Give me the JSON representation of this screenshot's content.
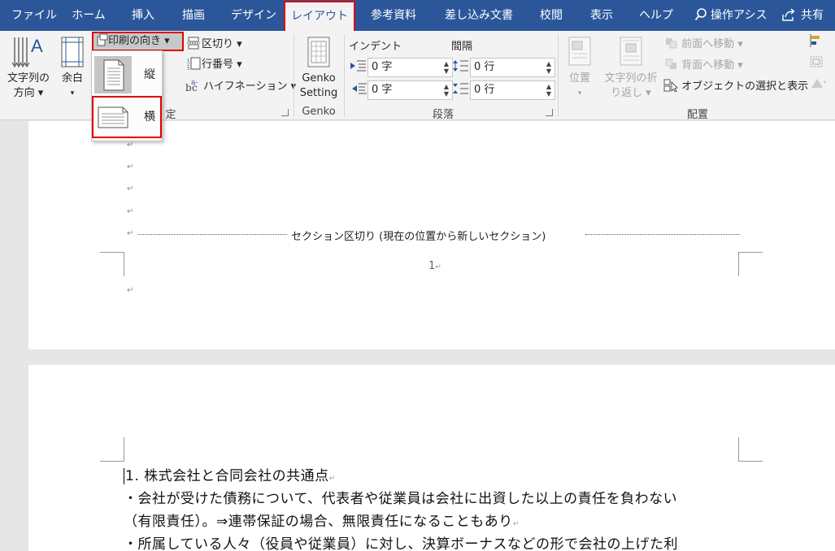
{
  "tabs": {
    "file": "ファイル",
    "home": "ホーム",
    "insert": "挿入",
    "draw": "描画",
    "design": "デザイン",
    "layout": "レイアウト",
    "references": "参考資料",
    "mailings": "差し込み文書",
    "review": "校閲",
    "view": "表示",
    "help": "ヘルプ",
    "tell_me": "操作アシス",
    "share": "共有"
  },
  "ribbon": {
    "page_setup": {
      "text_direction_line1": "文字列の",
      "text_direction_line2": "方向 ▾",
      "margins": "余白",
      "margins_arrow": "▾",
      "orientation": "印刷の向き ▾",
      "breaks": "区切り ▾",
      "line_numbers": "行番号 ▾",
      "hyphenation": "ハイフネーション ▾",
      "group_label_partial": "定"
    },
    "genko": {
      "button_line1": "Genko",
      "button_line2": "Setting",
      "group_label": "Genko"
    },
    "paragraph": {
      "indent_label": "インデント",
      "spacing_label": "間隔",
      "indent_left": "0 字",
      "indent_right": "0 字",
      "spacing_before": "0 行",
      "spacing_after": "0 行",
      "group_label": "段落"
    },
    "arrange": {
      "position": "位置",
      "position_arrow": "▾",
      "wrap_text_line1": "文字列の折",
      "wrap_text_line2": "り返し ▾",
      "bring_forward": "前面へ移動 ▾",
      "send_backward": "背面へ移動 ▾",
      "selection_pane": "オブジェクトの選択と表示",
      "group_label": "配置"
    }
  },
  "orientation_menu": {
    "portrait": "縦",
    "landscape": "横"
  },
  "document": {
    "section_break": "セクション区切り (現在の位置から新しいセクション)",
    "page_number": "1",
    "paragraph_mark": "↵",
    "lines": [
      "1. 株式会社と合同会社の共通点",
      "・会社が受けた債務について、代表者や従業員は会社に出資した以上の責任を負わない",
      "（有限責任）。⇒連帯保証の場合、無限責任になることもあり",
      "・所属している人々（役員や従業員）に対し、決算ボーナスなどの形で会社の上げた利"
    ]
  },
  "colors": {
    "accent": "#2b579a",
    "highlight_border": "#e00000",
    "ribbon_bg": "#f3f3f3",
    "doc_bg": "#e6e6e6"
  }
}
